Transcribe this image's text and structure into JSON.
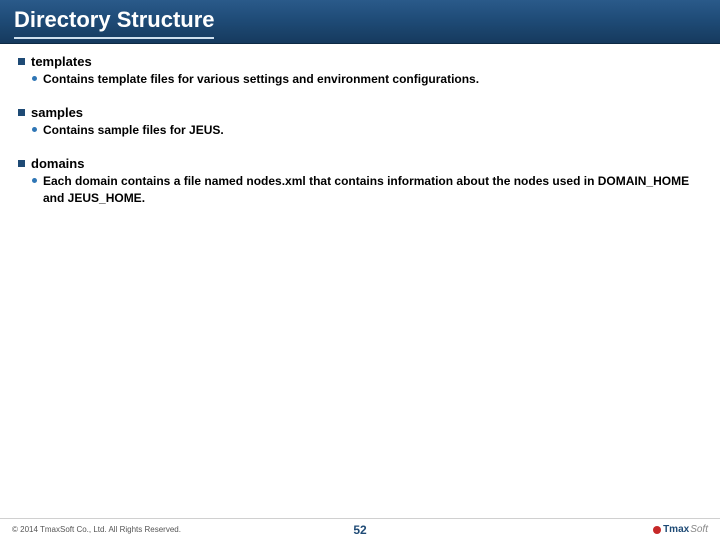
{
  "header": {
    "title": "Directory Structure"
  },
  "sections": [
    {
      "name": "templates",
      "desc": "Contains template files for various settings and environment configurations."
    },
    {
      "name": "samples",
      "desc": "Contains sample files for JEUS."
    },
    {
      "name": "domains",
      "desc": "Each domain contains a file named nodes.xml that contains information about the nodes used in DOMAIN_HOME and JEUS_HOME."
    }
  ],
  "footer": {
    "copyright": "© 2014 TmaxSoft Co., Ltd. All Rights Reserved.",
    "page": "52",
    "logo_main": "Tmax",
    "logo_sub": "Soft"
  }
}
